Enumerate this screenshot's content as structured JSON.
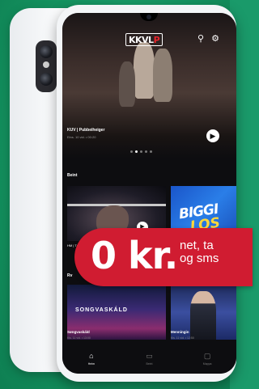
{
  "app": {
    "logo_left": "KKVL",
    "logo_right": "P"
  },
  "header": {
    "search_icon": "search-icon",
    "settings_icon": "gear-icon"
  },
  "hero": {
    "title": "KUV | Pubbeiheiger",
    "subtitle": "Eins. 10 vid. • 00:20",
    "carousel_pages": 5,
    "carousel_active": 1
  },
  "sections": [
    {
      "label": "Beint",
      "tiles": [
        {
          "title": "HM | Tv",
          "sub": "",
          "theme": "gymnastics"
        },
        {
          "title": "BIGGI",
          "title2": "LOS",
          "theme": "big-show"
        }
      ]
    },
    {
      "label": "Rv",
      "tiles": [
        {
          "title": "Søngvaskáld",
          "sub": "Kis. 11 vid. • 13:00",
          "banner": "SONGVASKÁLD"
        },
        {
          "title": "Menningin",
          "sub": "Kis. 11 vid. • 12:50"
        }
      ]
    }
  ],
  "bottom_nav": [
    {
      "label": "Heim",
      "icon": "home-icon",
      "active": true
    },
    {
      "label": "Beint",
      "icon": "tv-icon",
      "active": false
    },
    {
      "label": "Mappa",
      "icon": "folder-icon",
      "active": false
    }
  ],
  "promo": {
    "price": "0 kr.",
    "line1": "net, ta",
    "line2": "og sms"
  },
  "colors": {
    "background": "#1a9a6a",
    "badge": "#d01c31",
    "screen": "#0d0d10"
  }
}
